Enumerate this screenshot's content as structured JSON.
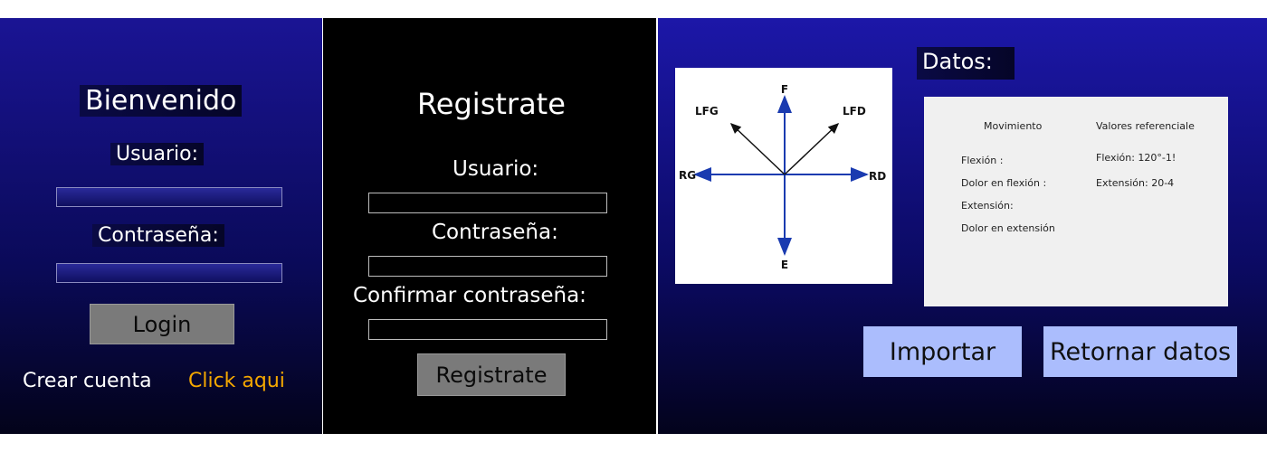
{
  "login": {
    "title": "Bienvenido",
    "user_label": "Usuario:",
    "user_value": "",
    "password_label": "Contraseña:",
    "password_value": "",
    "login_button": "Login",
    "create_account_text": "Crear cuenta",
    "click_here_link": "Click aqui"
  },
  "register": {
    "title": "Registrate",
    "user_label": "Usuario:",
    "password_label": "Contraseña:",
    "confirm_label": "Confirmar contraseña:",
    "register_button": "Registrate"
  },
  "data_panel": {
    "title": "Datos:",
    "diagram_labels": {
      "top": "F",
      "bottom": "E",
      "left": "RG",
      "right": "RD",
      "upper_left": "LFG",
      "upper_right": "LFD"
    },
    "table": {
      "header_left": "Movimiento",
      "header_right": "Valores referenciale",
      "rows_left": [
        "Flexión :",
        "Dolor en flexión :",
        "Extensión:",
        "Dolor en extensión"
      ],
      "rows_right": [
        "Flexión: 120°-1!",
        "Extensión:  20-4"
      ]
    },
    "import_button": "Importar",
    "return_button": "Retornar datos"
  },
  "colors": {
    "accent_orange": "#f5a800",
    "button_grey": "#7a7a7a",
    "button_blue": "#abbdfd",
    "arrow_blue": "#1a3bb0"
  }
}
